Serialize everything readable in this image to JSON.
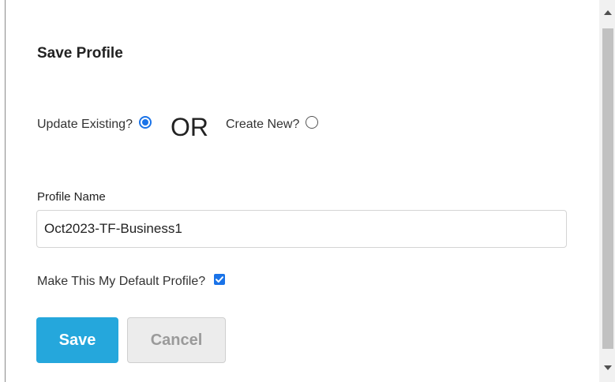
{
  "dialog": {
    "title": "Save Profile",
    "update_existing_label": "Update Existing?",
    "update_existing_selected": true,
    "or_label": "OR",
    "create_new_label": "Create New?",
    "create_new_selected": false,
    "profile_name_label": "Profile Name",
    "profile_name_value": "Oct2023-TF-Business1",
    "default_profile_label": "Make This My Default Profile?",
    "default_profile_checked": true,
    "save_label": "Save",
    "cancel_label": "Cancel"
  },
  "colors": {
    "accent": "#1a73e8",
    "save_button": "#25a7dc",
    "cancel_button": "#ececec"
  },
  "icons": {
    "radio_selected": "radio-selected-icon",
    "radio_unselected": "radio-unselected-icon",
    "checkbox_checked": "checkmark-icon",
    "scroll_up": "triangle-up-icon",
    "scroll_down": "triangle-down-icon"
  }
}
